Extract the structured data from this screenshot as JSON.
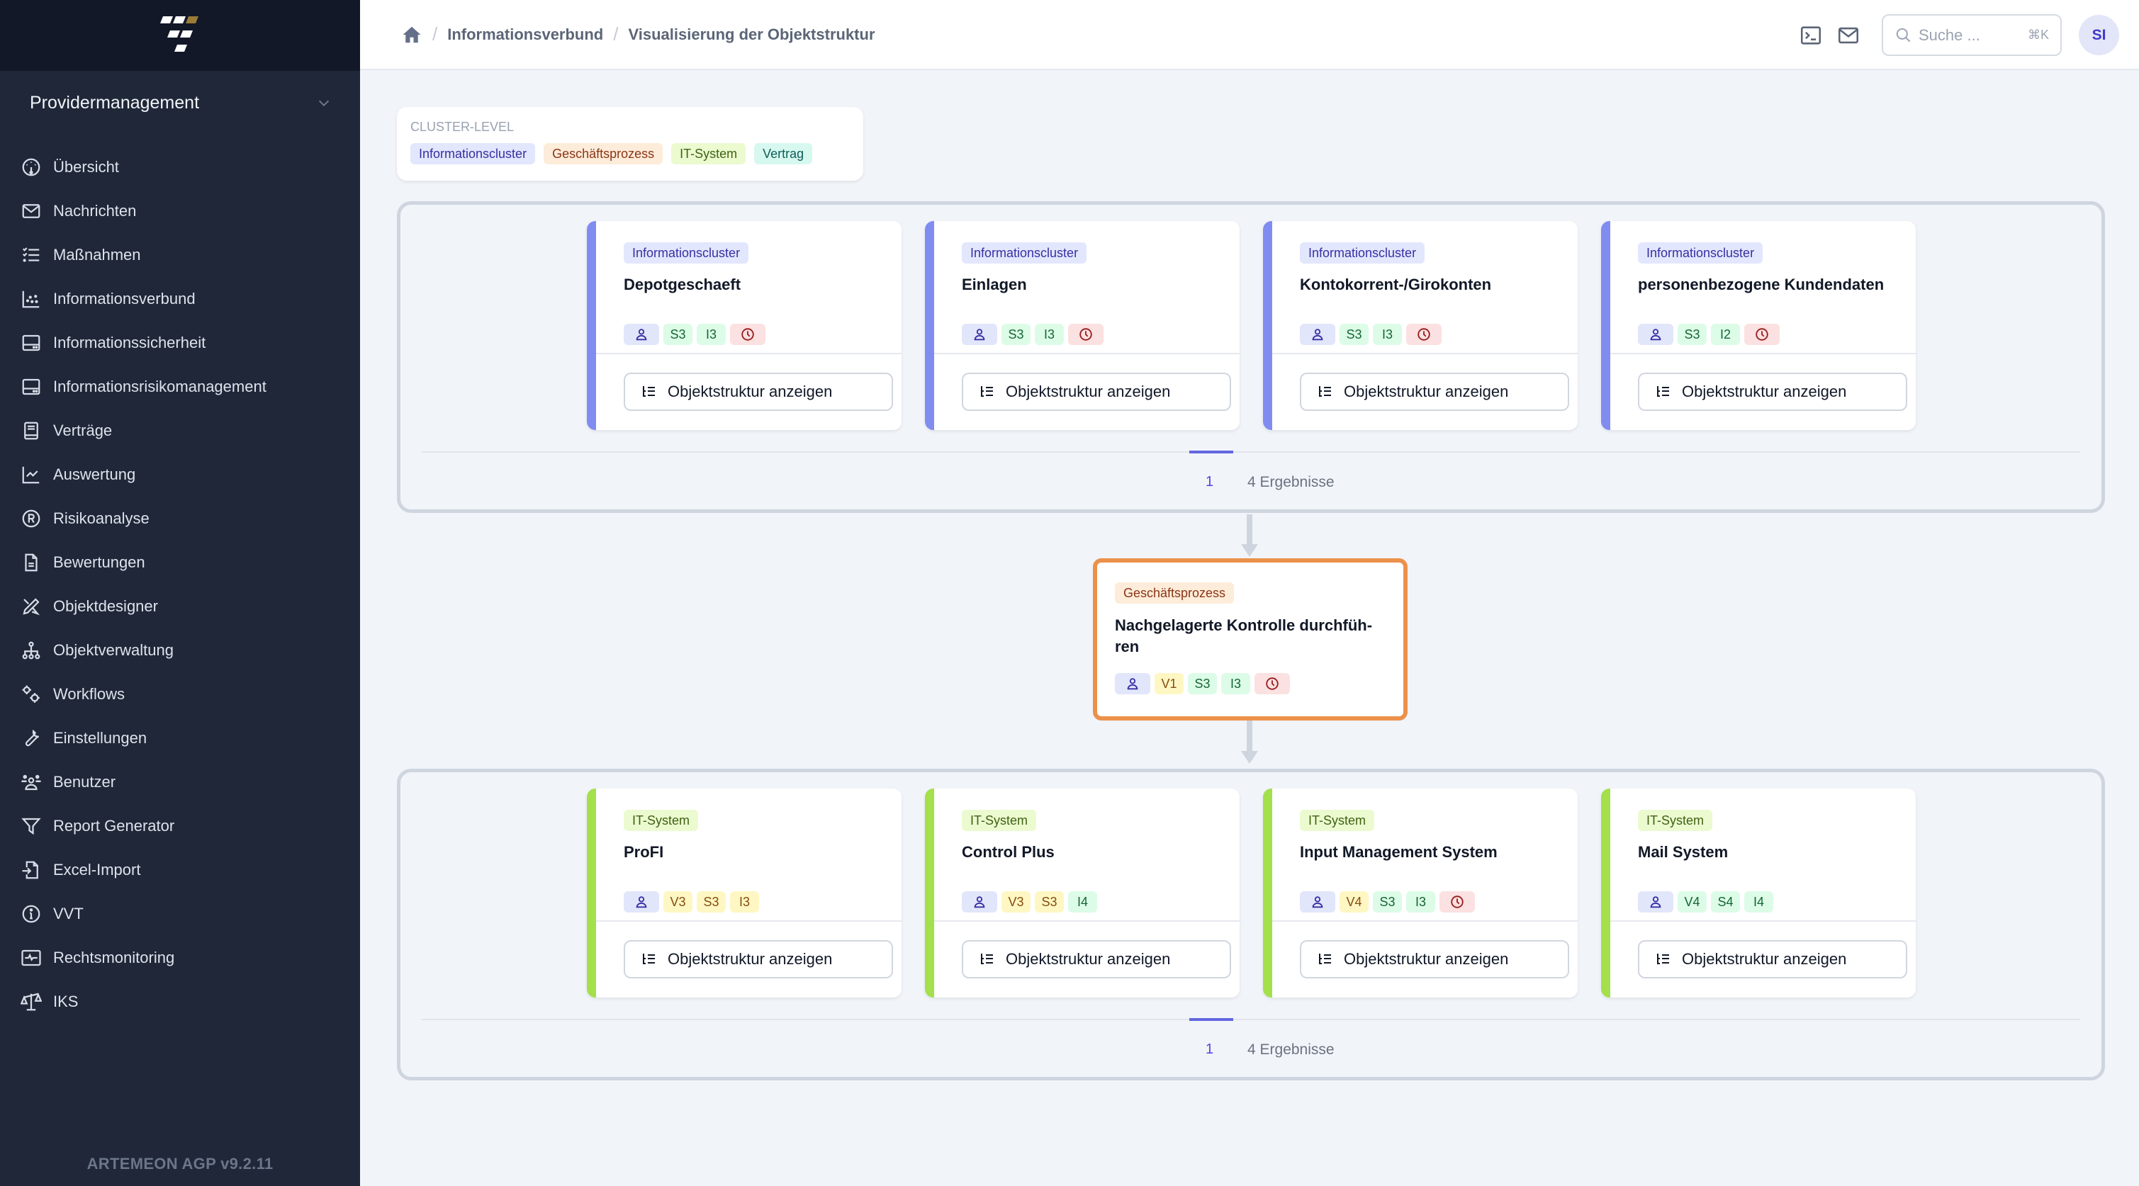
{
  "app": {
    "logo": "artemeon-logo",
    "org_selector": "Providermanagement",
    "version": "ARTEMEON AGP v9.2.11"
  },
  "sidebar": {
    "items": [
      {
        "label": "Übersicht",
        "icon": "dashboard-gauge-icon"
      },
      {
        "label": "Nachrichten",
        "icon": "envelope-icon"
      },
      {
        "label": "Maßnahmen",
        "icon": "checklist-icon"
      },
      {
        "label": "Informationsverbund",
        "icon": "scatter-chart-icon"
      },
      {
        "label": "Informationssicherheit",
        "icon": "server-icon"
      },
      {
        "label": "Informationsrisikomanagement",
        "icon": "server-icon"
      },
      {
        "label": "Verträge",
        "icon": "book-icon"
      },
      {
        "label": "Auswertung",
        "icon": "line-chart-icon"
      },
      {
        "label": "Risikoanalyse",
        "icon": "registered-icon"
      },
      {
        "label": "Bewertungen",
        "icon": "document-icon"
      },
      {
        "label": "Objektdesigner",
        "icon": "design-tools-icon"
      },
      {
        "label": "Objektverwaltung",
        "icon": "hierarchy-icon"
      },
      {
        "label": "Workflows",
        "icon": "cogs-icon"
      },
      {
        "label": "Einstellungen",
        "icon": "wrench-icon"
      },
      {
        "label": "Benutzer",
        "icon": "users-icon"
      },
      {
        "label": "Report Generator",
        "icon": "filter-icon"
      },
      {
        "label": "Excel-Import",
        "icon": "file-import-icon"
      },
      {
        "label": "VVT",
        "icon": "info-circle-icon"
      },
      {
        "label": "Rechtsmonitoring",
        "icon": "monitor-pulse-icon"
      },
      {
        "label": "IKS",
        "icon": "scale-icon"
      }
    ]
  },
  "header": {
    "breadcrumb": [
      "Informationsverbund",
      "Visualisierung der Objektstruktur"
    ],
    "search_placeholder": "Suche ...",
    "search_shortcut": "⌘K",
    "avatar_initials": "SI"
  },
  "legend": {
    "title": "CLUSTER-LEVEL",
    "tags": [
      "Informationscluster",
      "Geschäftsprozess",
      "IT-System",
      "Vertrag"
    ]
  },
  "button_label": "Objektstruktur anzeigen",
  "top_group": {
    "cards": [
      {
        "type": "Informationscluster",
        "title": "Depotgeschaeft",
        "badges": [
          {
            "kind": "user"
          },
          {
            "text": "S3",
            "color": "green"
          },
          {
            "text": "I3",
            "color": "green"
          },
          {
            "kind": "clock"
          }
        ]
      },
      {
        "type": "Informationscluster",
        "title": "Einlagen",
        "badges": [
          {
            "kind": "user"
          },
          {
            "text": "S3",
            "color": "green"
          },
          {
            "text": "I3",
            "color": "green"
          },
          {
            "kind": "clock"
          }
        ]
      },
      {
        "type": "Informationscluster",
        "title": "Kontokorrent-/Girokonten",
        "badges": [
          {
            "kind": "user"
          },
          {
            "text": "S3",
            "color": "green"
          },
          {
            "text": "I3",
            "color": "green"
          },
          {
            "kind": "clock"
          }
        ]
      },
      {
        "type": "Informationscluster",
        "title": "personenbezogene Kundendaten",
        "badges": [
          {
            "kind": "user"
          },
          {
            "text": "S3",
            "color": "green"
          },
          {
            "text": "I2",
            "color": "green"
          },
          {
            "kind": "clock"
          }
        ]
      }
    ],
    "page": "1",
    "result_count": "4 Ergebnisse"
  },
  "focus_card": {
    "type": "Geschäftsprozess",
    "title": "Nachgelagerte Kontrolle durchfüh-ren",
    "badges": [
      {
        "kind": "user"
      },
      {
        "text": "V1",
        "color": "yellow"
      },
      {
        "text": "S3",
        "color": "green"
      },
      {
        "text": "I3",
        "color": "green"
      },
      {
        "kind": "clock"
      }
    ]
  },
  "bottom_group": {
    "cards": [
      {
        "type": "IT-System",
        "title": "ProFI",
        "badges": [
          {
            "kind": "user"
          },
          {
            "text": "V3",
            "color": "yellow"
          },
          {
            "text": "S3",
            "color": "yellow"
          },
          {
            "text": "I3",
            "color": "yellow"
          }
        ]
      },
      {
        "type": "IT-System",
        "title": "Control Plus",
        "badges": [
          {
            "kind": "user"
          },
          {
            "text": "V3",
            "color": "yellow"
          },
          {
            "text": "S3",
            "color": "yellow"
          },
          {
            "text": "I4",
            "color": "green"
          }
        ]
      },
      {
        "type": "IT-System",
        "title": "Input Management System",
        "badges": [
          {
            "kind": "user"
          },
          {
            "text": "V4",
            "color": "yellow"
          },
          {
            "text": "S3",
            "color": "green"
          },
          {
            "text": "I3",
            "color": "green"
          },
          {
            "kind": "clock"
          }
        ]
      },
      {
        "type": "IT-System",
        "title": "Mail System",
        "badges": [
          {
            "kind": "user"
          },
          {
            "text": "V4",
            "color": "green"
          },
          {
            "text": "S4",
            "color": "green"
          },
          {
            "text": "I4",
            "color": "green"
          }
        ]
      }
    ],
    "page": "1",
    "result_count": "4 Ergebnisse"
  },
  "colors": {
    "informationscluster": "#818cf0",
    "it_system": "#a3e04c",
    "geschaeftsprozess": "#eb914a",
    "accent": "#4f46e5"
  }
}
